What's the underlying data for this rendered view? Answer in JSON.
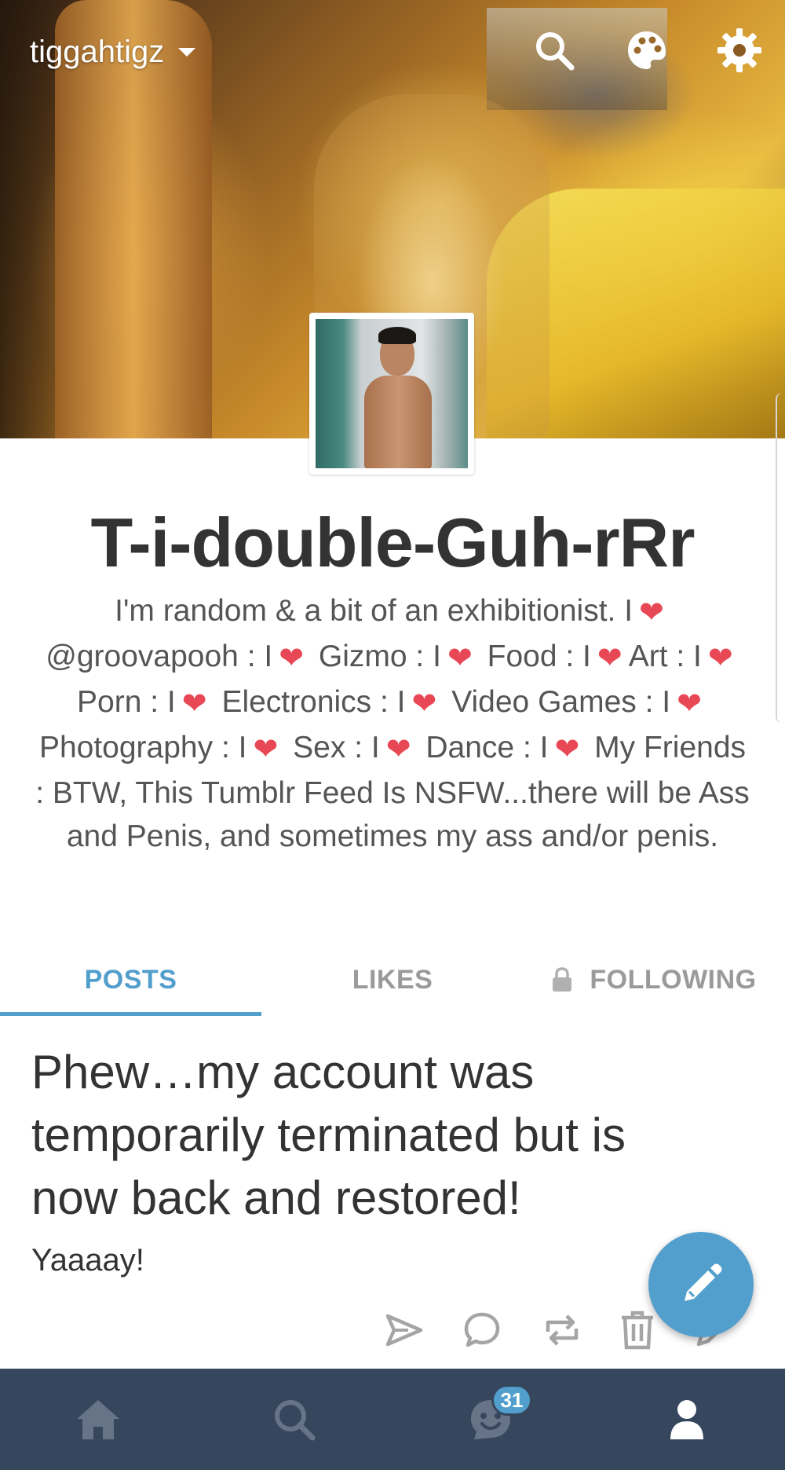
{
  "header": {
    "blog_name": "tiggahtigz",
    "icons": [
      "search-icon",
      "palette-icon",
      "gear-icon"
    ]
  },
  "blog": {
    "title": "T-i-double-Guh-rRr",
    "description_parts": [
      "I'm random & a bit of an exhibitionist. I",
      "@groovapooh : I",
      "Gizmo : I",
      "Food : I",
      "Art : I",
      "Porn : I",
      "Electronics : I",
      "Video Games : I",
      "Photography : I",
      "Sex : I",
      "Dance : I",
      "My Friends : BTW, This Tumblr Feed Is NSFW...there will be Ass and Penis, and sometimes my ass and/or penis."
    ],
    "heart_glyph": "❤"
  },
  "tabs": [
    {
      "label": "POSTS",
      "active": true
    },
    {
      "label": "LIKES",
      "active": false
    },
    {
      "label": "FOLLOWING",
      "active": false,
      "locked": true
    }
  ],
  "post": {
    "title": "Phew…my account was temporarily terminated but is now back and restored!",
    "body": "Yaaaay!",
    "actions": [
      "share-icon",
      "reply-icon",
      "reblog-icon",
      "delete-icon",
      "edit-icon"
    ]
  },
  "bottom_nav": {
    "items": [
      "home-icon",
      "explore-icon",
      "activity-icon",
      "account-icon"
    ],
    "activity_badge": "31"
  },
  "colors": {
    "accent": "#529ecc",
    "nav_background": "#36465d",
    "heart": "#e84855",
    "title_text": "#333333",
    "body_text": "#555555"
  }
}
